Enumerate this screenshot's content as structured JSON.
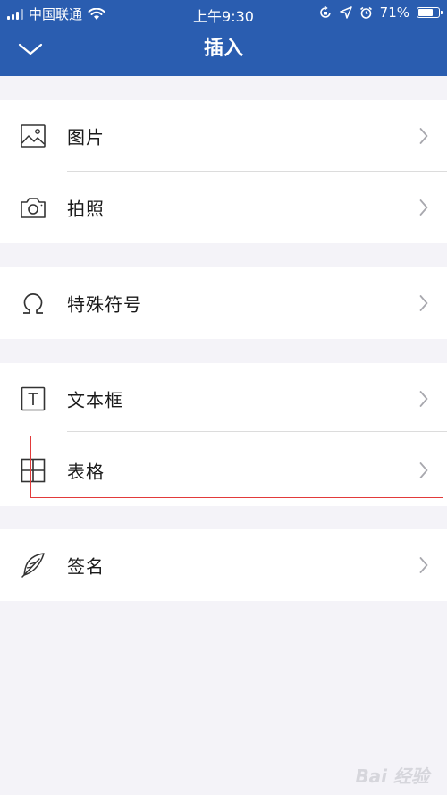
{
  "status_bar": {
    "carrier": "中国联通",
    "time": "上午9:30",
    "battery_percent": "71%",
    "battery_level": 0.71
  },
  "header": {
    "title": "插入",
    "back_icon": "chevron-down-icon"
  },
  "menu": {
    "items": [
      {
        "label": "图片",
        "icon": "image-icon"
      },
      {
        "label": "拍照",
        "icon": "camera-icon"
      },
      {
        "label": "特殊符号",
        "icon": "omega-icon"
      },
      {
        "label": "文本框",
        "icon": "textbox-icon"
      },
      {
        "label": "表格",
        "icon": "table-icon",
        "highlighted": true
      },
      {
        "label": "签名",
        "icon": "feather-pen-icon"
      }
    ]
  },
  "colors": {
    "header_bg": "#2a5db0",
    "page_bg": "#f4f3f8",
    "highlight_border": "#e23a3a"
  },
  "watermark": "Bai 经验"
}
